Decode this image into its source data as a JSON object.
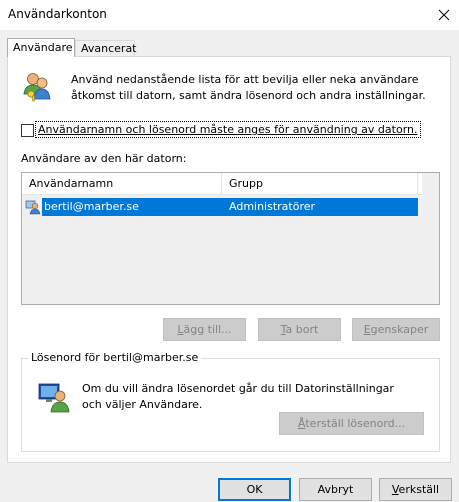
{
  "window": {
    "title": "Användarkonton"
  },
  "tabs": [
    {
      "label": "Användare"
    },
    {
      "label": "Avancerat"
    }
  ],
  "intro": {
    "text": "Använd nedanstående lista för att bevilja eller neka användare åtkomst till datorn, samt ändra lösenord och andra inställningar."
  },
  "require_login": {
    "label": "Användarnamn och lösenord måste anges för användning av datorn.",
    "checked": false
  },
  "users_list": {
    "label": "Användare av den här datorn:",
    "columns": [
      "Användarnamn",
      "Grupp"
    ],
    "rows": [
      {
        "name": "bertil@marber.se",
        "group": "Administratörer",
        "selected": true
      }
    ]
  },
  "list_buttons": {
    "add_prefix": "",
    "add_underline": "L",
    "add_rest": "ägg till...",
    "remove_prefix": "",
    "remove_underline": "T",
    "remove_rest": "a bort",
    "props_prefix": "",
    "props_underline": "E",
    "props_rest": "genskaper"
  },
  "password_group": {
    "title": "Lösenord för bertil@marber.se",
    "text": "Om du vill ändra lösenordet går du till Datorinställningar och väljer Användare.",
    "reset_prefix": "",
    "reset_underline": "Å",
    "reset_rest": "terställ lösenord..."
  },
  "dialog_buttons": {
    "ok": "OK",
    "cancel": "Avbryt",
    "apply_prefix": "",
    "apply_underline": "V",
    "apply_rest": "erkställ"
  },
  "colors": {
    "selection": "#0078d7",
    "dialog_bg": "#f0f0f0"
  }
}
